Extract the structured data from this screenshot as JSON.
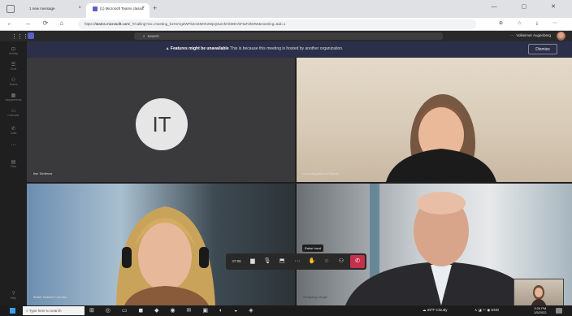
{
  "browser": {
    "tabs": [
      {
        "label": "1 new message"
      },
      {
        "label": "(1) Microsoft Teams classic",
        "sublabel": "Calling"
      }
    ],
    "new_tab": "+",
    "url_prefix": "https://",
    "url_domain": "teams.microsoft.com",
    "url_rest": "/_#/calling?ctx=meeting_b2HvVgZWFb2ct4M0K2MpQ3umhHkMEVbFtaFZkMW&meeting=&id=1",
    "nav": "← → ⟳ ⌂",
    "win_buttons": "— ▢ ✕",
    "icons": "⊕ ☆ ⤓ ⋯"
  },
  "teams": {
    "search_placeholder": "Search",
    "user_name": "Volkeimer Augenberg",
    "more": "···"
  },
  "rail": [
    {
      "icon": "⊡",
      "label": "Activity"
    },
    {
      "icon": "☰",
      "label": "Chat"
    },
    {
      "icon": "⚇",
      "label": "Teams"
    },
    {
      "icon": "▦",
      "label": "Assignments"
    },
    {
      "icon": "▭",
      "label": "Calendar"
    },
    {
      "icon": "✆",
      "label": "Calls"
    },
    {
      "icon": "⋯",
      "label": ""
    },
    {
      "icon": "▤",
      "label": "Files"
    },
    {
      "icon": "?",
      "label": "Help"
    }
  ],
  "banner": {
    "bold": "Features might be unavailable",
    "text": " This is because this meeting is hosted by another organization.",
    "dismiss": "Dismiss"
  },
  "participants": [
    {
      "initials": "IT",
      "name": "Ilse Tahlbrow"
    },
    {
      "name": "Lena Magdalena Fritsche"
    },
    {
      "name": "Bodet Kassem Carolan"
    },
    {
      "name": "Wolfgang Langer"
    }
  ],
  "controls": {
    "time": "47:06",
    "camera": "▆",
    "mic": "🎙",
    "share": "⬒",
    "more": "···",
    "raise_hand": "✋",
    "react": "☺",
    "people": "⚇",
    "hang_up": "✆",
    "tooltip": "Raise hand"
  },
  "taskbar": {
    "search": "Type here to search",
    "apps": "⊞ ◎ ▭ ◼ ◆ ◉ ✉ ▣ ◐ ◒ ◈",
    "weather": "☁ 29°F Cloudy",
    "tray": "∧ ◪ ⚐ ◉ ENG",
    "time": "3:26 PM",
    "date": "1/5/2022"
  }
}
